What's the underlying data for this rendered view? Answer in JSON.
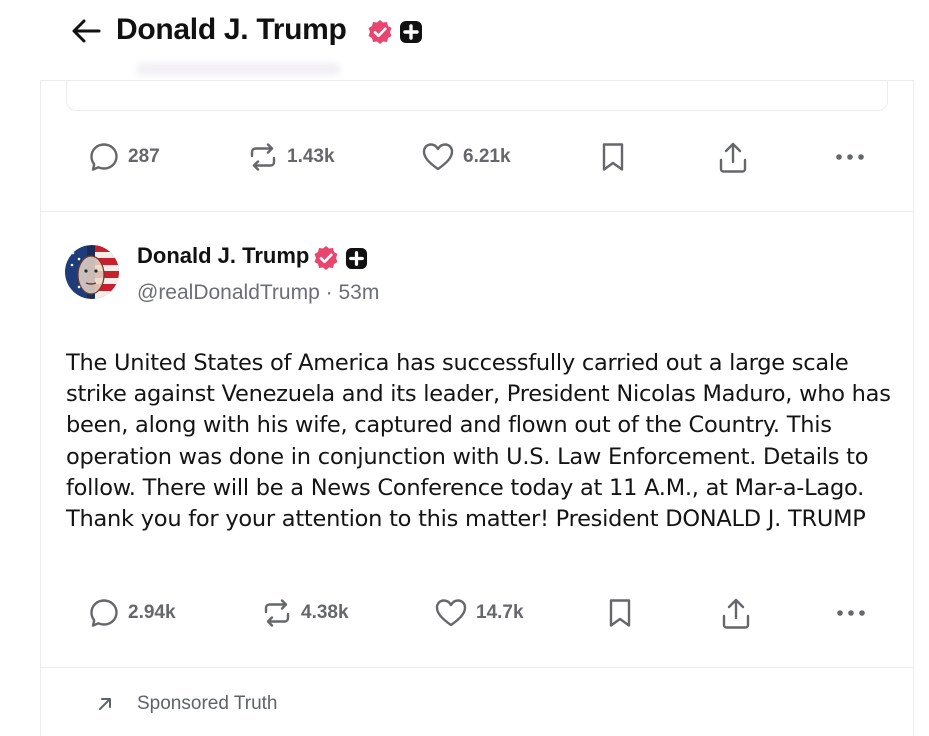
{
  "header": {
    "title": "Donald J. Trump"
  },
  "previous_post": {
    "actions": {
      "replies": "287",
      "retruths": "1.43k",
      "likes": "6.21k"
    }
  },
  "post": {
    "author_name": "Donald J. Trump",
    "handle": "@realDonaldTrump",
    "separator": "·",
    "time_ago": "53m",
    "text": "The United States of America has successfully carried out a large scale strike against Venezuela and its leader, President Nicolas Maduro, who has been, along with his wife, captured and flown out of the Country. This operation was done in conjunction with U.S. Law Enforcement. Details to follow. There will be a News Conference today at 11 A.M., at Mar-a-Lago. Thank you for your attention to this matter! President DONALD J. TRUMP",
    "actions": {
      "replies": "2.94k",
      "retruths": "4.38k",
      "likes": "14.7k"
    }
  },
  "sponsored": {
    "label": "Sponsored Truth"
  },
  "colors": {
    "verified_badge": "#e8466f",
    "icon_gray": "#65676b",
    "border": "#ecebf0"
  },
  "icons": {
    "back": "arrow-left-icon",
    "verified": "verified-badge-icon",
    "plus": "plus-badge-icon",
    "reply": "speech-bubble-icon",
    "retruth": "retruth-arrows-icon",
    "like": "heart-icon",
    "bookmark": "bookmark-icon",
    "share": "share-icon",
    "more": "ellipsis-icon",
    "sponsored": "arrow-up-right-icon"
  }
}
